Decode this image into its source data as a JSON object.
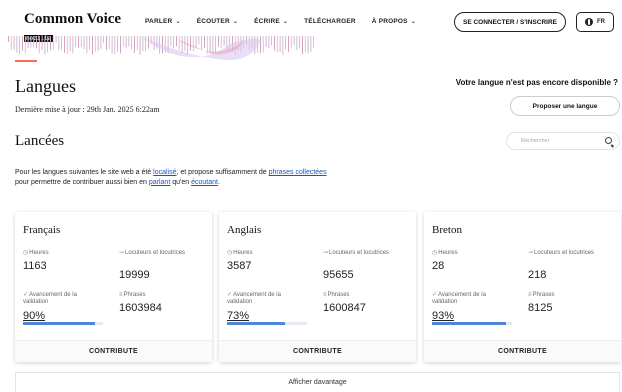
{
  "header": {
    "logo_title": "Common Voice",
    "logo_badge": "mozilla",
    "nav": [
      {
        "label": "PARLER",
        "dropdown": true
      },
      {
        "label": "ÉCOUTER",
        "dropdown": true
      },
      {
        "label": "ÉCRIRE",
        "dropdown": true
      },
      {
        "label": "TÉLÉCHARGER",
        "dropdown": false
      },
      {
        "label": "À PROPOS",
        "dropdown": true
      }
    ],
    "login_label": "SE CONNECTER / S'INSCRIRE",
    "language_label": "FR"
  },
  "page": {
    "title": "Langues",
    "last_update": "Dernière mise à jour : 29th Jan. 2025 6:22am",
    "missing_language": "Votre langue n'est pas encore disponible ?",
    "propose_label": "Proposer une langue",
    "section_title": "Lancées",
    "search_placeholder": "Rechercher",
    "intro": {
      "part1": "Pour les langues suivantes le site web a été ",
      "link1": "localisé",
      "part2": ", et propose suffisamment de ",
      "link2": "phrases collectées",
      "part3": " pour permettre de contribuer aussi bien en ",
      "link3": "parlant",
      "part4": " qu'en ",
      "link4": "écoutant",
      "part5": "."
    },
    "more_label": "Afficher davantage"
  },
  "labels": {
    "hours": "Heures",
    "speakers": "Locuteurs et locutrices",
    "validation": "Avancement de la validation",
    "phrases": "Phrases",
    "contribute": "CONTRIBUTE"
  },
  "languages": [
    {
      "name": "Français",
      "hours": "1163",
      "speakers": "19999",
      "validation": "90%",
      "validation_fraction": 0.9,
      "phrases": "1603984"
    },
    {
      "name": "Anglais",
      "hours": "3587",
      "speakers": "95655",
      "validation": "73%",
      "validation_fraction": 0.73,
      "phrases": "1600847"
    },
    {
      "name": "Breton",
      "hours": "28",
      "speakers": "218",
      "validation": "93%",
      "validation_fraction": 0.93,
      "phrases": "8125"
    }
  ],
  "colors": {
    "accent": "#f46e5b",
    "progress": "#4f86d6",
    "link": "#1a55c7"
  }
}
